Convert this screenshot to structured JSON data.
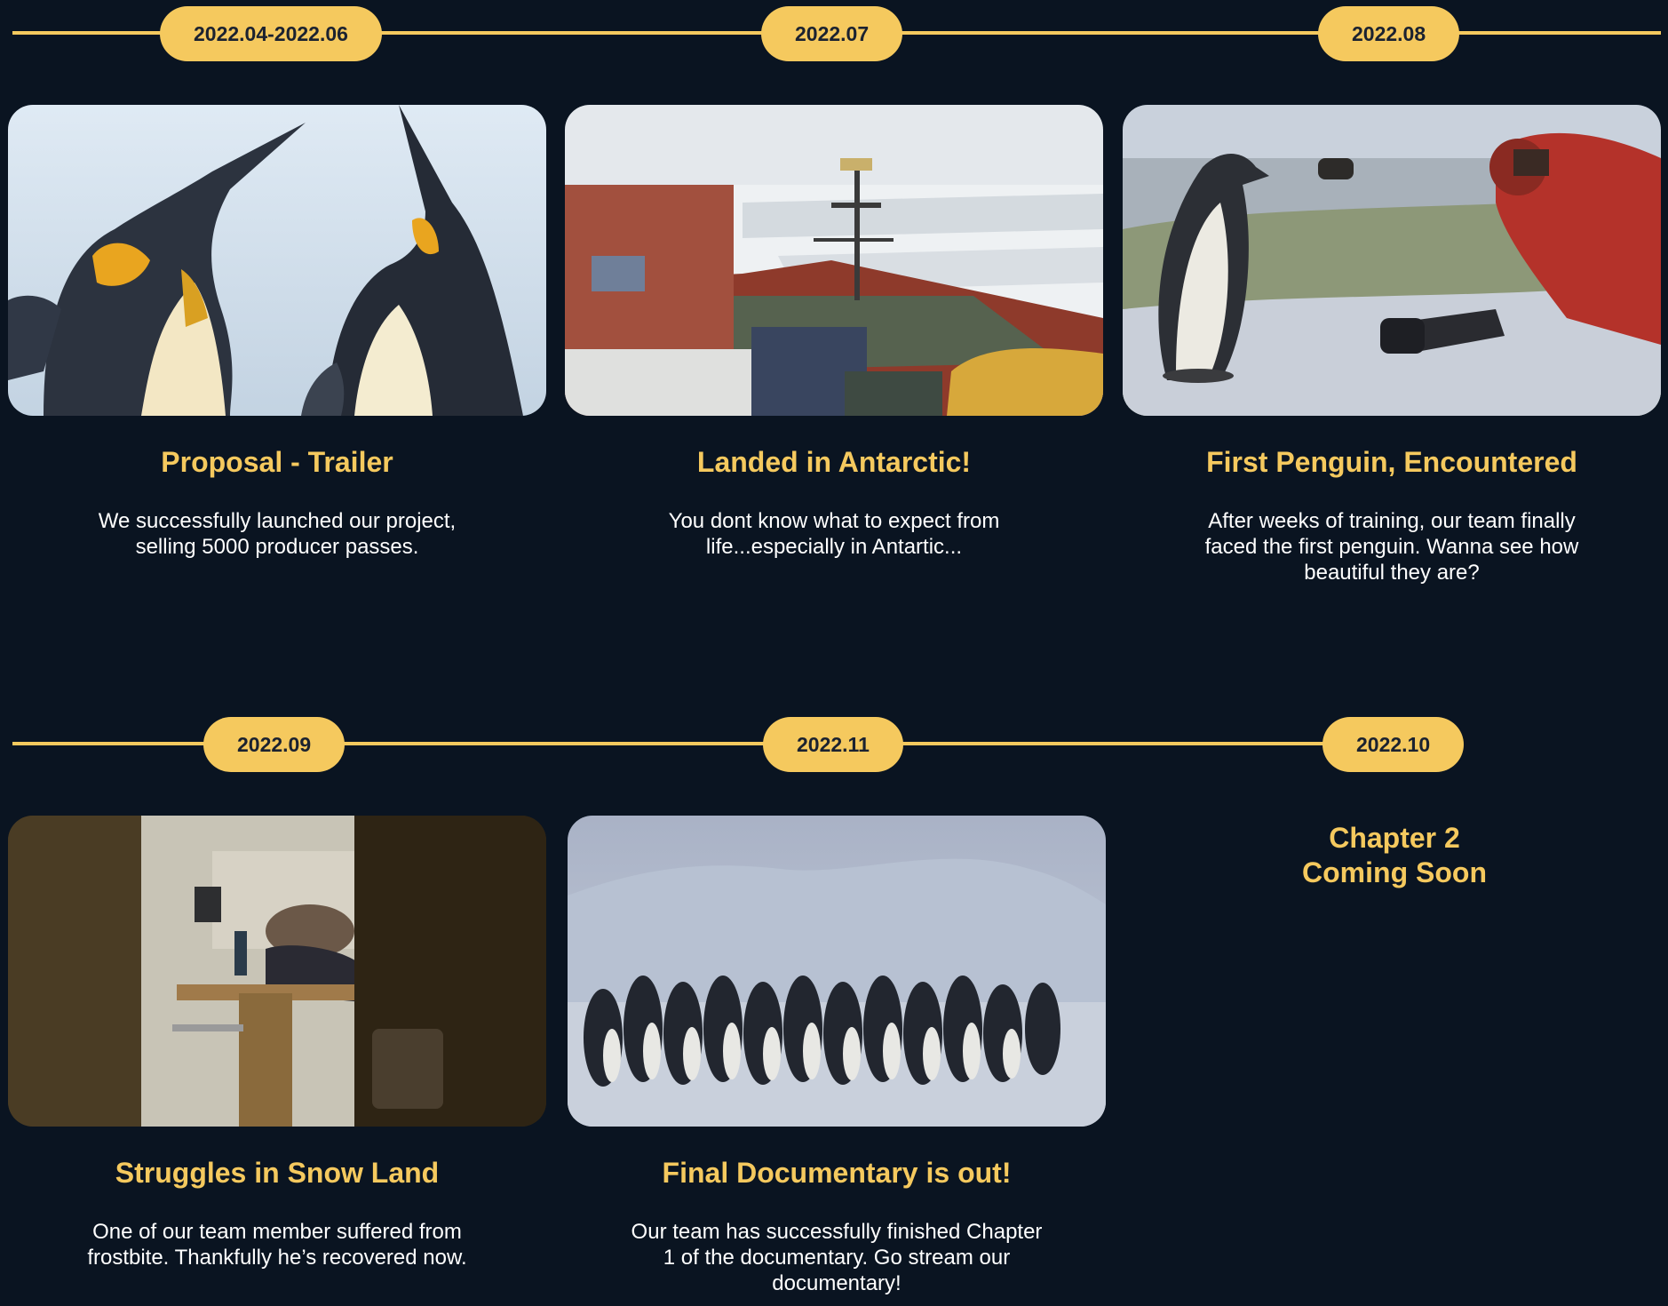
{
  "timeline_rows": [
    {
      "dates": [
        "2022.04-2022.06",
        "2022.07",
        "2022.08"
      ],
      "cards": [
        {
          "title": "Proposal - Trailer",
          "description": "We successfully launched our project, selling 5000 producer passes.",
          "image": "king-penguins-photo"
        },
        {
          "title": "Landed in Antarctic!",
          "description": "You dont know what to expect from life...especially in Antartic...",
          "image": "icebreaker-ship-photo"
        },
        {
          "title": "First Penguin, Encountered",
          "description": "After weeks of training, our team finally faced the first penguin. Wanna see how beautiful they are?",
          "image": "penguin-and-cameraman-photo"
        }
      ]
    },
    {
      "dates": [
        "2022.09",
        "2022.11",
        "2022.10"
      ],
      "cards": [
        {
          "title": "Struggles in Snow Land",
          "description": "One of our team member suffered from frostbite. Thankfully he’s recovered now.",
          "image": "team-member-resting-photo"
        },
        {
          "title": "Final Documentary is out!",
          "description": "Our team has successfully finished Chapter 1 of the documentary. Go stream our documentary!",
          "image": "emperor-penguin-huddle-photo"
        }
      ],
      "chapter_note": "Chapter 2\nComing Soon"
    }
  ],
  "colors": {
    "background": "#0a1421",
    "accent": "#f5c95e",
    "pill_text": "#1b2230",
    "body_text": "#ffffff"
  }
}
